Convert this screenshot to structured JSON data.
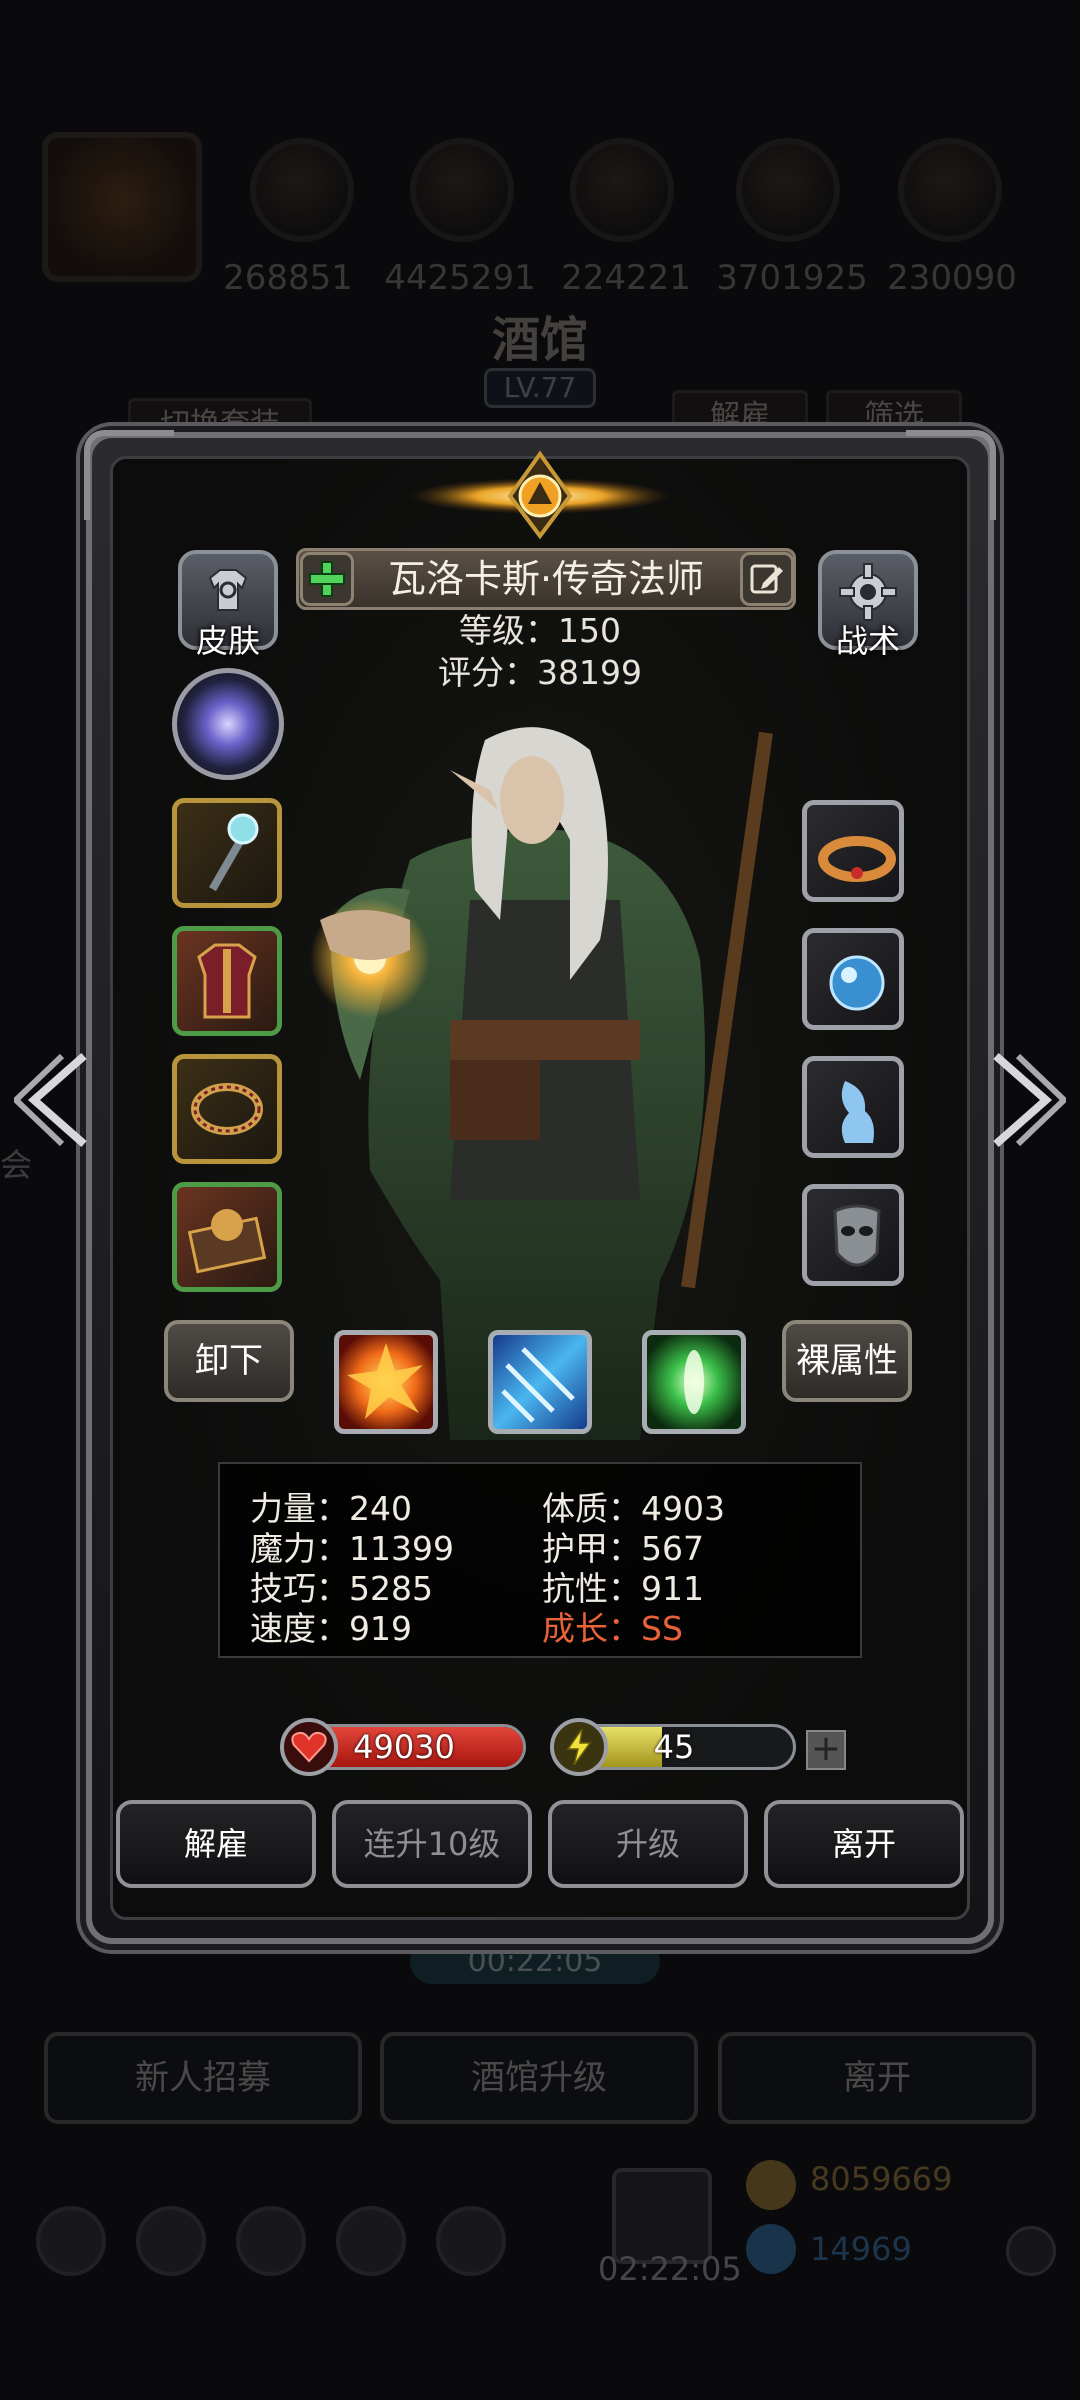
{
  "background": {
    "resources": [
      "268851",
      "4425291",
      "224221",
      "3701925",
      "230090"
    ],
    "title": "酒馆",
    "level": "LV.77",
    "switch_outfit": "切换套装",
    "dismiss": "解雇",
    "filter": "筛选",
    "timer": "00:22:05",
    "buttons": [
      "新人招募",
      "酒馆升级",
      "离开"
    ],
    "gift_timer": "02:22:05",
    "gold": "8059669",
    "gems": "14969",
    "side_char": "会"
  },
  "hero": {
    "name": "瓦洛卡斯·传奇法师",
    "level_text": "等级：150",
    "score_text": "评分：38199"
  },
  "side_buttons": {
    "skin": "皮肤",
    "tactics": "战术"
  },
  "left_equipment": [
    "staff-icon",
    "armor-icon",
    "bracelet-icon",
    "spellbook-icon"
  ],
  "right_equipment": [
    "crown-icon",
    "orb-icon",
    "spirit-icon",
    "mask-icon"
  ],
  "actions_row": {
    "unequip": "卸下",
    "base_attrs": "裸属性"
  },
  "skills": [
    "fire-burst-icon",
    "ice-shards-icon",
    "green-light-icon"
  ],
  "stats": {
    "strength": "力量：240",
    "magic": "魔力：11399",
    "skill": "技巧：5285",
    "speed": "速度：919",
    "constitution": "体质：4903",
    "armor": "护甲：567",
    "resistance": "抗性：911",
    "growth": "成长：SS"
  },
  "bars": {
    "hp_value": "49030",
    "hp_fill": 1.0,
    "energy_value": "45",
    "energy_fill": 0.45
  },
  "bottom_buttons": {
    "dismiss": "解雇",
    "level10": "连升10级",
    "upgrade": "升级",
    "leave": "离开"
  },
  "colors": {
    "growth": "#e8623a",
    "hp": "#d6322a",
    "energy": "#d8cc3c"
  }
}
